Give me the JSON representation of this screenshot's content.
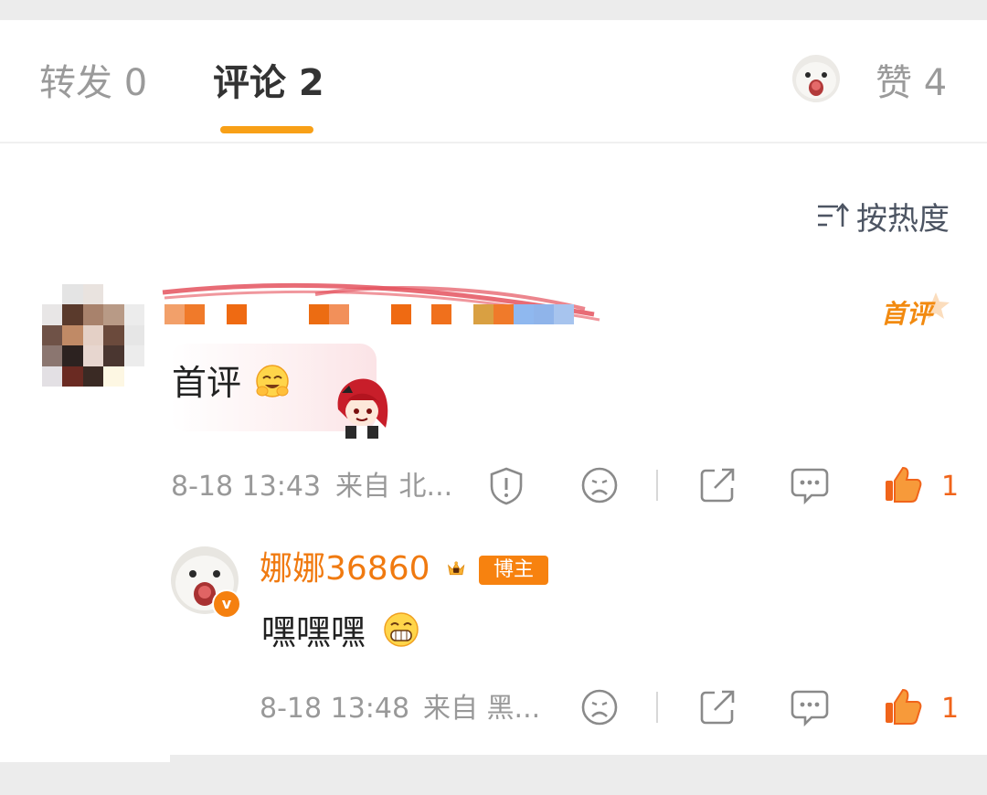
{
  "tabs": {
    "repost": "转发 0",
    "comment": "评论 2",
    "likes": "赞 4"
  },
  "sort": {
    "label": "按热度"
  },
  "comment1": {
    "badge": "首评",
    "text": "首评",
    "time": "8-18 13:43",
    "location": "来自 北...",
    "like_count": "1"
  },
  "reply": {
    "username": "娜娜36860",
    "host_badge": "博主",
    "verified": "v",
    "text": "嘿嘿嘿",
    "time": "8-18 13:48",
    "location": "来自 黑...",
    "like_count": "1"
  },
  "colors": {
    "accent": "#f8a017",
    "username": "#f07a10",
    "like": "#f0641a",
    "meta": "#999999"
  },
  "icons": [
    "sort-icon",
    "report-icon",
    "dislike-icon",
    "share-icon",
    "comment-icon",
    "like-icon"
  ]
}
